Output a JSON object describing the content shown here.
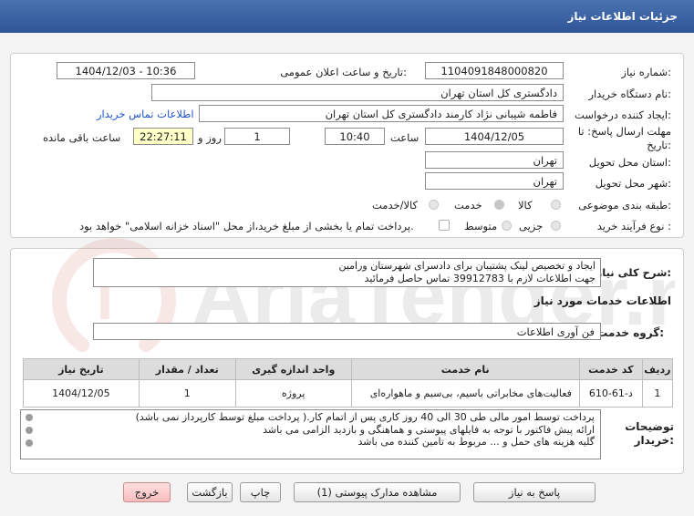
{
  "header": {
    "title": "جزئیات اطلاعات نیاز"
  },
  "details": {
    "need_number_label": "شماره نیاز:",
    "need_number": "1104091848000820",
    "announce_label": "تاریخ و ساعت اعلان عمومی:",
    "announce_value": "1404/12/03 - 10:36",
    "buyer_org_label": "نام دستگاه خریدار:",
    "buyer_org": "دادگستری کل استان تهران",
    "creator_label": "ایجاد کننده درخواست:",
    "creator": "فاطمه شیبانی نژاد کارمند دادگستری کل استان تهران",
    "contact_link": "اطلاعات تماس خریدار",
    "deadline_label_1": "مهلت ارسال پاسخ: تا",
    "deadline_label_2": "تاریخ:",
    "deadline_date": "1404/12/05",
    "time_label": "ساعت",
    "deadline_time": "10:40",
    "days_value": "1",
    "days_label": "روز و",
    "remaining_time": "22:27:11",
    "remaining_label": "ساعت باقی مانده",
    "province_label": "استان محل تحویل:",
    "province": "تهران",
    "city_label": "شهر محل تحویل:",
    "city": "تهران",
    "category_label": "طبقه بندی موضوعی:",
    "category_options": [
      "کالا",
      "خدمت",
      "کالا/خدمت"
    ],
    "process_label": "نوع فرآیند خرید :",
    "process_options": [
      "جزیی",
      "متوسط"
    ],
    "payment_note": "پرداخت تمام یا بخشی از مبلغ خرید،از محل \"اسناد خزانه اسلامی\" خواهد بود."
  },
  "summary": {
    "label": "شرح کلی نیاز:",
    "lines": [
      "ایجاد و تخصیص لینک پشتیبان برای دادسرای شهرستان ورامین",
      "جهت اطلاعات لازم با  39912783  تماس حاصل فرمائید"
    ],
    "services_title": "اطلاعات خدمات مورد نیاز",
    "service_group_label": "گروه خدمت:",
    "service_group": "فن آوری اطلاعات",
    "table": {
      "headers": [
        "ردیف",
        "کد خدمت",
        "نام خدمت",
        "واحد اندازه گیری",
        "تعداد / مقدار",
        "تاریخ نیاز"
      ],
      "rows": [
        [
          "1",
          "د-61-610",
          "فعالیت‌های مخابراتی باسیم، بی‌سیم و ماهواره‌ای",
          "پروژه",
          "1",
          "1404/12/05"
        ]
      ]
    },
    "buyer_notes_label_1": "توضیحات",
    "buyer_notes_label_2": "خریدار:",
    "buyer_notes": [
      "پرداخت توسط امور مالی طی 30 الی 40 روز کاری پس از اتمام کار.( پرداخت مبلغ توسط کارپرداز نمی باشد)",
      "ارائه پیش فاکتور با توجه به فایلهای پیوستی و هماهنگی و بازدید الزامی می باشد",
      "گلیه هزینه های حمل و ... مربوط به تامین کننده می باشد"
    ]
  },
  "buttons": {
    "reply": "پاسخ به نیاز",
    "attachments": "مشاهده مدارک پیوستی (1)",
    "print": "چاپ",
    "back": "بازگشت",
    "exit": "خروج"
  },
  "watermark": {
    "text": "AriaTender.net"
  },
  "colors": {
    "header": "#2f5597",
    "link": "#2255cc",
    "timer_bg": "#ffffc8",
    "exit_btn": "#f6bcbc"
  }
}
